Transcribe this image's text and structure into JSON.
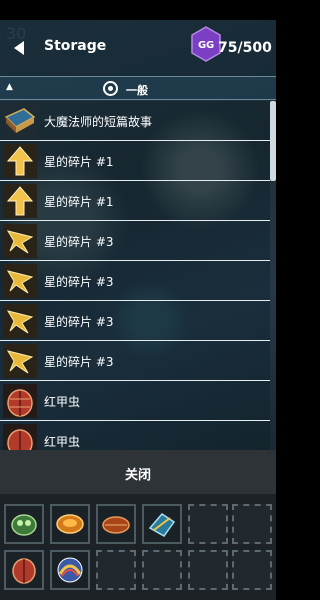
{
  "header": {
    "title": "Storage",
    "counter": "75/500",
    "bg_number": "30"
  },
  "category": {
    "label": "一般"
  },
  "items": [
    {
      "name": "大魔法师的短篇故事",
      "icon": "book-icon"
    },
    {
      "name": "星的碎片 #1",
      "icon": "star-shard-icon"
    },
    {
      "name": "星的碎片 #1",
      "icon": "star-shard-icon"
    },
    {
      "name": "星的碎片 #3",
      "icon": "star-shard-icon"
    },
    {
      "name": "星的碎片 #3",
      "icon": "star-shard-icon"
    },
    {
      "name": "星的碎片 #3",
      "icon": "star-shard-icon"
    },
    {
      "name": "星的碎片 #3",
      "icon": "star-shard-icon"
    },
    {
      "name": "红甲虫",
      "icon": "red-beetle-icon"
    },
    {
      "name": "红甲虫",
      "icon": "red-beetle-icon"
    }
  ],
  "close_button": {
    "label": "关闭"
  },
  "inventory": {
    "slots": [
      {
        "icon": "green-gem-icon"
      },
      {
        "icon": "orange-orb-icon"
      },
      {
        "icon": "orange-disc-icon"
      },
      {
        "icon": "blue-shell-icon"
      },
      {
        "icon": "empty-slot"
      },
      {
        "icon": "empty-slot"
      },
      {
        "icon": "red-beetle-icon"
      },
      {
        "icon": "rainbow-orb-icon"
      },
      {
        "icon": "empty-slot"
      },
      {
        "icon": "empty-slot"
      },
      {
        "icon": "empty-slot"
      },
      {
        "icon": "empty-slot"
      }
    ]
  },
  "colors": {
    "header_bg": "#142834",
    "row_border": "#e6edf0",
    "close_bar_bg": "#2e3338",
    "inventory_bg": "#1d2226",
    "gg_purple": "#7b3fc4"
  }
}
